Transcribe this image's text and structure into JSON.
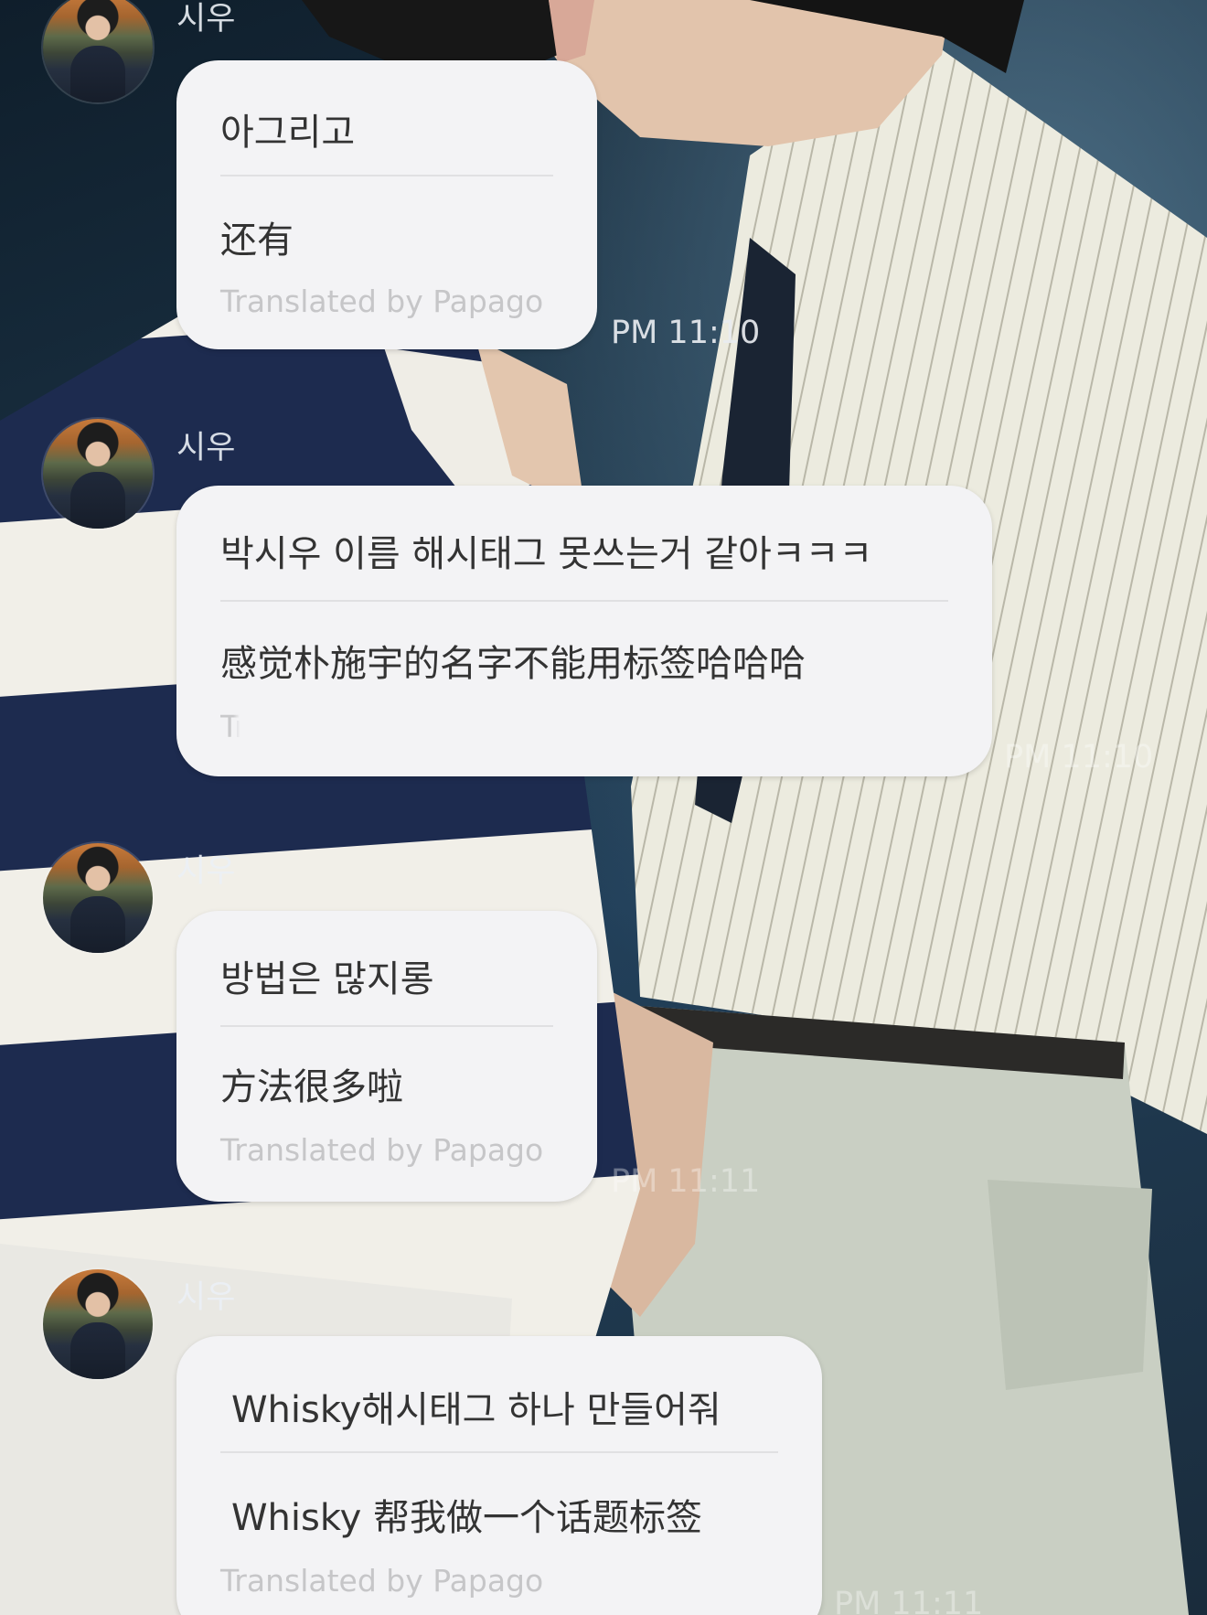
{
  "messages": [
    {
      "sender": "시우",
      "original": "아그리고",
      "translation": "还有",
      "credit": "Translated by Papago",
      "time": "PM 11:10"
    },
    {
      "sender": "시우",
      "original": "박시우 이름 해시태그 못쓰는거 같아ㅋㅋㅋ",
      "translation": "感觉朴施宇的名字不能用标签哈哈哈",
      "credit": "Translated by Papago",
      "time": "PM 11:10"
    },
    {
      "sender": "시우",
      "original": "방법은 많지롱",
      "translation": "方法很多啦",
      "credit": "Translated by Papago",
      "time": "PM 11:11"
    },
    {
      "sender": "시우",
      "original": "Whisky해시태그 하나 만들어줘",
      "translation": "Whisky 帮我做一个话题标签",
      "credit": "Translated by Papago",
      "time": "PM 11:11"
    }
  ],
  "colors": {
    "bubble": "#f3f3f5",
    "text": "#333333",
    "credit": "#c6c6c8",
    "timestamp": "#e8ecf0"
  },
  "icons": {
    "avatar": "profile-photo-avatar"
  }
}
